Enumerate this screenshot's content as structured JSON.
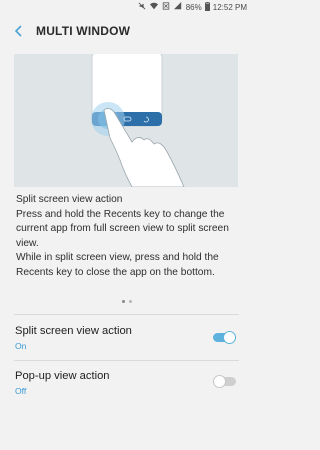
{
  "statusbar": {
    "battery": "86%",
    "time": "12:52 PM"
  },
  "header": {
    "title": "MULTI WINDOW"
  },
  "description": {
    "heading": "Split screen view action",
    "lines": [
      "Press and hold the Recents key to change the current app from full screen view to split screen view.",
      "While in split screen view, press and hold the Recents key to close the app on the bottom."
    ]
  },
  "pager": {
    "pages": 2,
    "current": 1
  },
  "settings": [
    {
      "title": "Split screen view action",
      "status": "On",
      "enabled": true
    },
    {
      "title": "Pop-up view action",
      "status": "Off",
      "enabled": false
    }
  ],
  "colors": {
    "accent": "#5db3dc",
    "off_status": "#48a6d6"
  }
}
